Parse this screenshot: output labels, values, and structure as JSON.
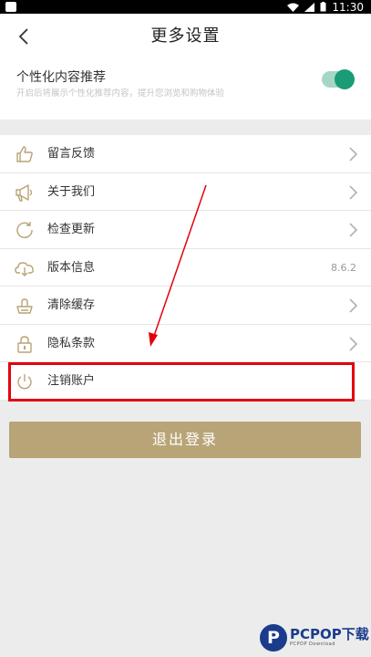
{
  "status_bar": {
    "time": "11:30"
  },
  "header": {
    "title": "更多设置"
  },
  "personalization": {
    "label": "个性化内容推荐",
    "description": "开启后将展示个性化推荐内容，提升您浏览和购物体验",
    "enabled": true
  },
  "menu": {
    "items": [
      {
        "label": "留言反馈",
        "icon": "thumbs-up-icon"
      },
      {
        "label": "关于我们",
        "icon": "megaphone-icon"
      },
      {
        "label": "检查更新",
        "icon": "refresh-icon"
      },
      {
        "label": "版本信息",
        "icon": "cloud-icon",
        "value": "8.6.2"
      },
      {
        "label": "清除缓存",
        "icon": "clean-icon"
      },
      {
        "label": "隐私条款",
        "icon": "lock-icon"
      },
      {
        "label": "注销账户",
        "icon": "power-icon"
      }
    ]
  },
  "logout": {
    "label": "退出登录"
  },
  "watermark": {
    "brand": "PCPOP下载",
    "sub": "PCPOP Download"
  },
  "colors": {
    "accent": "#b8a476",
    "toggle": "#1a9c76",
    "highlight": "#e3000f",
    "icon": "#b8a476"
  }
}
